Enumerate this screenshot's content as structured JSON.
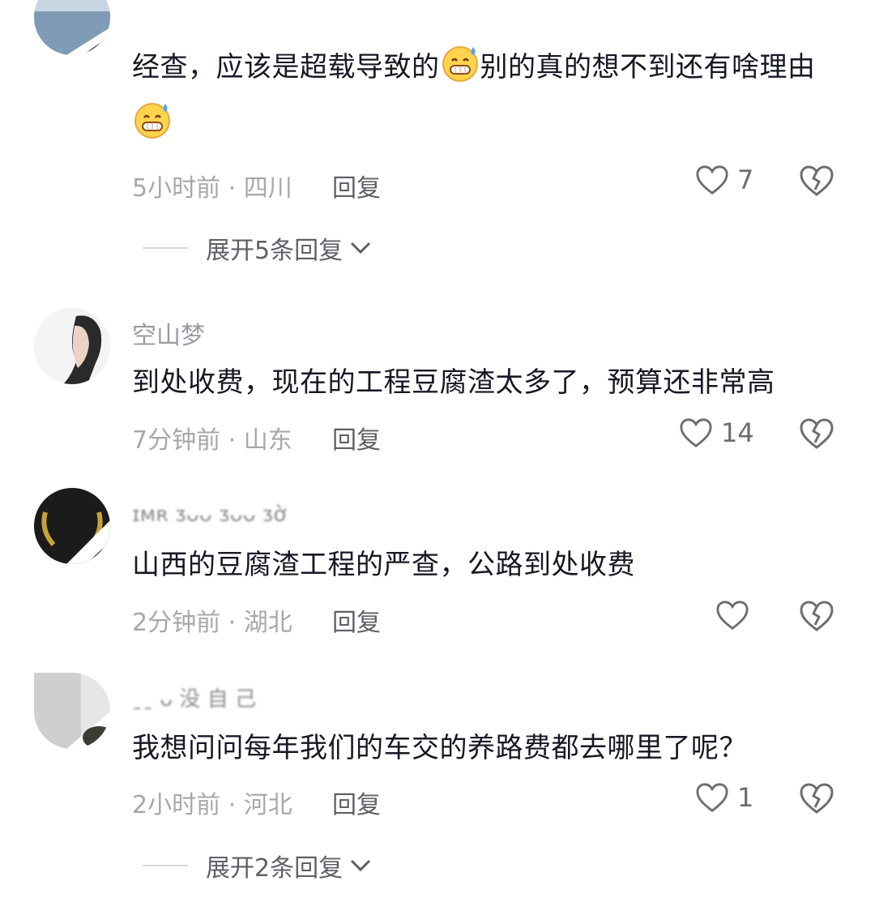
{
  "comments": [
    {
      "username": "",
      "text_before": "经查，应该是超载导致的",
      "text_middle": "别的真的想不到还有啥理由",
      "time_location": "5小时前 · 四川",
      "reply_label": "回复",
      "likes": "7",
      "expand_label": "展开5条回复",
      "emoji": "sweat-grin-emoji"
    },
    {
      "username": "空山梦",
      "text": "到处收费，现在的工程豆腐渣太多了，预算还非常高",
      "time_location": "7分钟前 · 山东",
      "reply_label": "回复",
      "likes": "14"
    },
    {
      "username": "ɪᴍʀ ᴣᴗᴗ ᴣᴗᴗ ᴣờ",
      "text": "山西的豆腐渣工程的严查，公路到处收费",
      "time_location": "2分钟前 · 湖北",
      "reply_label": "回复",
      "likes": ""
    },
    {
      "username": "ˍˍ ᴗ 没 自 己",
      "text": "我想问问每年我们的车交的养路费都去哪里了呢？",
      "time_location": "2小时前 · 河北",
      "reply_label": "回复",
      "likes": "1",
      "expand_label": "展开2条回复"
    }
  ],
  "icons": {
    "like": "heart-outline-icon",
    "dislike": "broken-heart-icon",
    "expand": "chevron-down-icon"
  },
  "colors": {
    "text": "#161823",
    "meta": "#a7a8ad",
    "action": "#5e6067",
    "emoji_face": "#ffd34d"
  }
}
